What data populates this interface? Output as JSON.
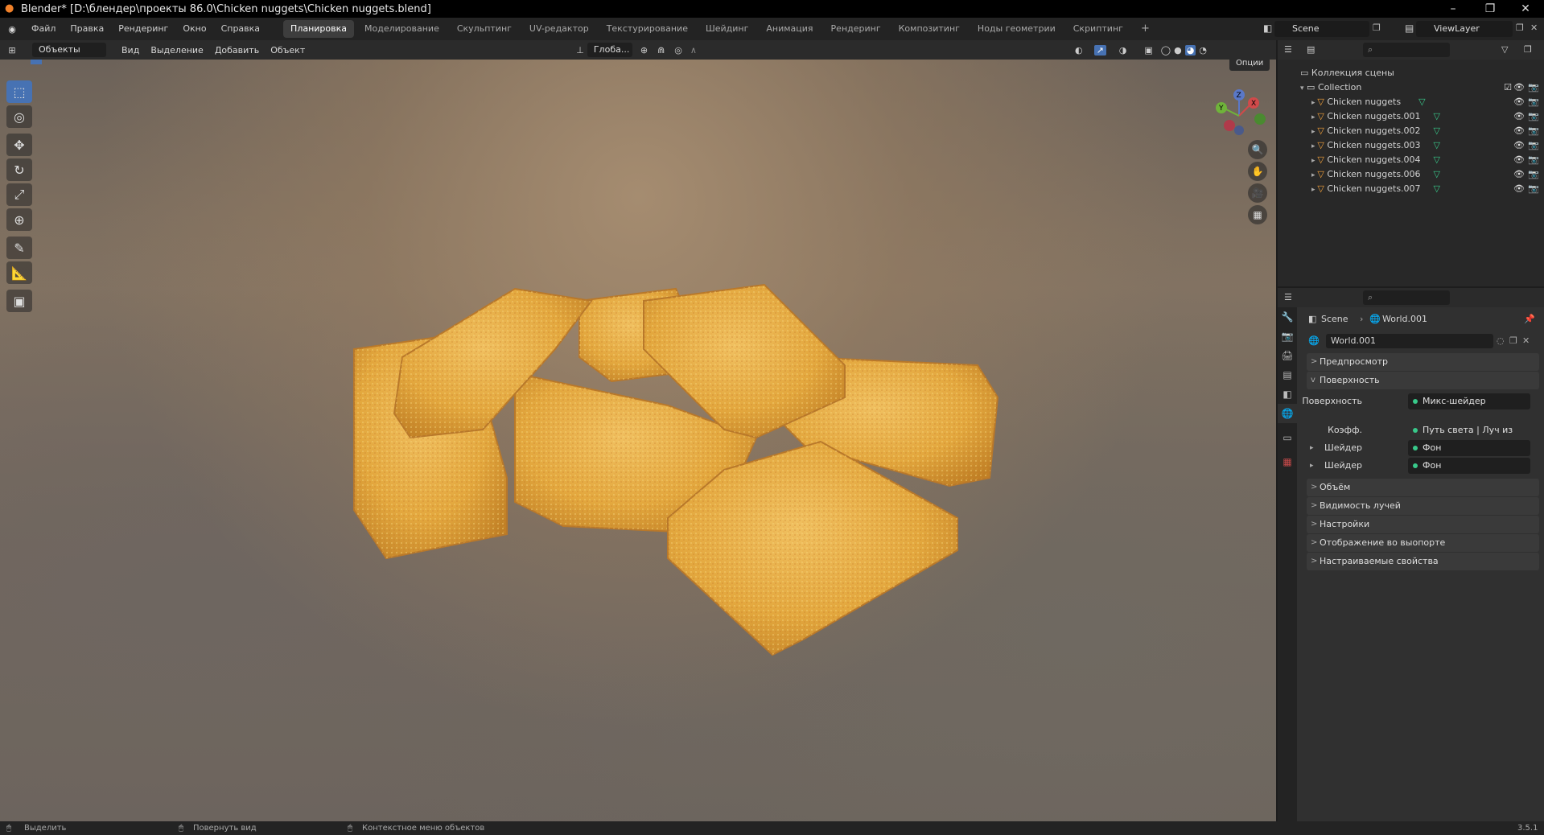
{
  "window": {
    "title": "Blender* [D:\\блендер\\проекты 86.0\\Chicken nuggets\\Chicken nuggets.blend]",
    "minimize": "–",
    "maximize": "❐",
    "close": "✕"
  },
  "menu": {
    "items": [
      "Файл",
      "Правка",
      "Рендеринг",
      "Окно",
      "Справка"
    ],
    "workspaces": [
      "Планировка",
      "Моделирование",
      "Скульптинг",
      "UV-редактор",
      "Текстурирование",
      "Шейдинг",
      "Анимация",
      "Рендеринг",
      "Композитинг",
      "Ноды геометрии",
      "Скриптинг"
    ],
    "active_workspace_index": 0,
    "add_tab": "+",
    "scene": "Scene",
    "view_layer": "ViewLayer"
  },
  "viewport_header": {
    "mode": "Объекты",
    "menus": [
      "Вид",
      "Выделение",
      "Добавить",
      "Объект"
    ],
    "transform_orientation": "Глоба...",
    "options": "Опции"
  },
  "gizmo": {
    "x": "X",
    "y": "Y",
    "z": "Z"
  },
  "outliner": {
    "scene_collection": "Коллекция сцены",
    "collection": "Collection",
    "objects": [
      "Chicken nuggets",
      "Chicken nuggets.001",
      "Chicken nuggets.002",
      "Chicken nuggets.003",
      "Chicken nuggets.004",
      "Chicken nuggets.006",
      "Chicken nuggets.007"
    ]
  },
  "properties": {
    "breadcrumb_scene": "Scene",
    "breadcrumb_sep": "›",
    "breadcrumb_world": "World.001",
    "world_name": "World.001",
    "sections": {
      "preview": "Предпросмотр",
      "surface": "Поверхность",
      "volume": "Объём",
      "ray_visibility": "Видимость лучей",
      "settings": "Настройки",
      "viewport_display": "Отображение во выопорте",
      "custom_props": "Настраиваемые свойства"
    },
    "surface_fields": [
      {
        "label": "Поверхность",
        "value": "Микс-шейдер"
      },
      {
        "label": "Коэфф.",
        "value": "Путь света | Луч из камеры"
      },
      {
        "label": "Шейдер",
        "value": "Фон"
      },
      {
        "label": "Шейдер",
        "value": "Фон"
      }
    ]
  },
  "statusbar": {
    "select": "Выделить",
    "rotate": "Повернуть вид",
    "context": "Контекстное меню объектов",
    "version": "3.5.1"
  },
  "colors": {
    "accent": "#4772b3",
    "nugget_light": "#e9b24c",
    "nugget_dark": "#c98b2a",
    "mesh_icon": "#f09f3a",
    "data_icon": "#38c98a"
  }
}
